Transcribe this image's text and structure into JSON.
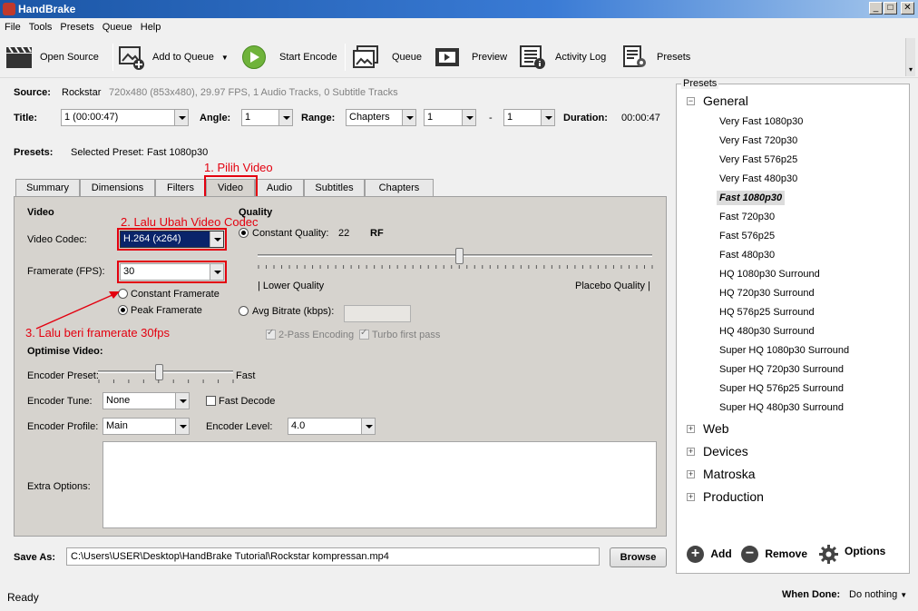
{
  "window": {
    "title": "HandBrake"
  },
  "menu": [
    "File",
    "Tools",
    "Presets",
    "Queue",
    "Help"
  ],
  "toolbar": {
    "open_source": "Open Source",
    "add_to_queue": "Add to Queue",
    "start_encode": "Start Encode",
    "queue": "Queue",
    "preview": "Preview",
    "activity_log": "Activity Log",
    "presets": "Presets"
  },
  "source": {
    "label": "Source:",
    "name": "Rockstar",
    "info": "720x480 (853x480), 29.97 FPS, 1 Audio Tracks, 0 Subtitle Tracks"
  },
  "title_row": {
    "title_label": "Title:",
    "title_value": "1 (00:00:47)",
    "angle_label": "Angle:",
    "angle_value": "1",
    "range_label": "Range:",
    "range_value": "Chapters",
    "range_start": "1",
    "range_sep": "-",
    "range_end": "1",
    "duration_label": "Duration:",
    "duration_value": "00:00:47"
  },
  "presets_row": {
    "label": "Presets:",
    "selected_label": "Selected Preset:",
    "selected_value": "Fast 1080p30"
  },
  "tabs": [
    "Summary",
    "Dimensions",
    "Filters",
    "Video",
    "Audio",
    "Subtitles",
    "Chapters"
  ],
  "annotations": {
    "step1": "1. Pilih Video",
    "step2": "2. Lalu Ubah Video Codec",
    "step3": "3. Lalu beri framerate 30fps"
  },
  "video": {
    "section_title": "Video",
    "codec_label": "Video Codec:",
    "codec_value": "H.264 (x264)",
    "framerate_label": "Framerate (FPS):",
    "framerate_value": "30",
    "constant_framerate": "Constant Framerate",
    "peak_framerate": "Peak Framerate"
  },
  "quality": {
    "section_title": "Quality",
    "constant_quality_label": "Constant Quality:",
    "constant_quality_value": "22",
    "rf_label": "RF",
    "slider_level": 0.51,
    "lower_label": "| Lower Quality",
    "placebo_label": "Placebo Quality |",
    "avg_bitrate_label": "Avg Bitrate (kbps):",
    "two_pass_label": "2-Pass Encoding",
    "turbo_label": "Turbo first pass"
  },
  "optimise": {
    "section_title": "Optimise Video:",
    "preset_label": "Encoder Preset:",
    "preset_value_label": "Fast",
    "preset_slider_level": 0.45,
    "tune_label": "Encoder Tune:",
    "tune_value": "None",
    "fast_decode_label": "Fast Decode",
    "profile_label": "Encoder Profile:",
    "profile_value": "Main",
    "level_label": "Encoder Level:",
    "level_value": "4.0",
    "extra_label": "Extra Options:"
  },
  "save": {
    "label": "Save As:",
    "path": "C:\\Users\\USER\\Desktop\\HandBrake Tutorial\\Rockstar kompressan.mp4",
    "browse": "Browse"
  },
  "presets_panel": {
    "group_title": "Presets",
    "general": "General",
    "general_items": [
      "Very Fast 1080p30",
      "Very Fast 720p30",
      "Very Fast 576p25",
      "Very Fast 480p30",
      "Fast 1080p30",
      "Fast 720p30",
      "Fast 576p25",
      "Fast 480p30",
      "HQ 1080p30 Surround",
      "HQ 720p30 Surround",
      "HQ 576p25 Surround",
      "HQ 480p30 Surround",
      "Super HQ 1080p30 Surround",
      "Super HQ 720p30 Surround",
      "Super HQ 576p25 Surround",
      "Super HQ 480p30 Surround"
    ],
    "selected_item": "Fast 1080p30",
    "other_groups": [
      "Web",
      "Devices",
      "Matroska",
      "Production"
    ],
    "add": "Add",
    "remove": "Remove",
    "options": "Options"
  },
  "status": {
    "text": "Ready",
    "when_done_label": "When Done:",
    "when_done_value": "Do nothing"
  }
}
